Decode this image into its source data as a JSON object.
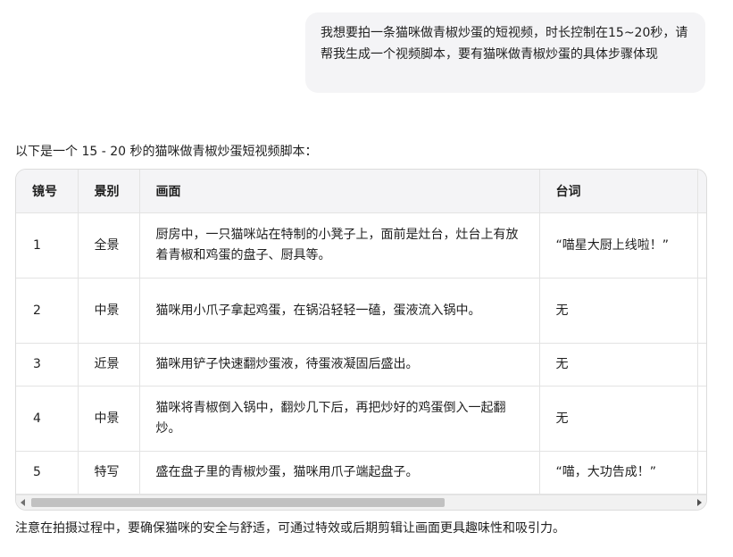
{
  "user_message": "我想要拍一条猫咪做青椒炒蛋的短视频，时长控制在15~20秒，请帮我生成一个视频脚本，要有猫咪做青椒炒蛋的具体步骤体现",
  "intro": "以下是一个 15 - 20 秒的猫咪做青椒炒蛋短视频脚本：",
  "table": {
    "headers": [
      "镜号",
      "景别",
      "画面",
      "台词"
    ],
    "rows": [
      {
        "num": "1",
        "shot": "全景",
        "scene": "厨房中，一只猫咪站在特制的小凳子上，面前是灶台，灶台上有放着青椒和鸡蛋的盘子、厨具等。",
        "line": "“喵星大厨上线啦！”"
      },
      {
        "num": "2",
        "shot": "中景",
        "scene": "猫咪用小爪子拿起鸡蛋，在锅沿轻轻一磕，蛋液流入锅中。",
        "line": "无"
      },
      {
        "num": "3",
        "shot": "近景",
        "scene": "猫咪用铲子快速翻炒蛋液，待蛋液凝固后盛出。",
        "line": "无"
      },
      {
        "num": "4",
        "shot": "中景",
        "scene": "猫咪将青椒倒入锅中，翻炒几下后，再把炒好的鸡蛋倒入一起翻炒。",
        "line": "无"
      },
      {
        "num": "5",
        "shot": "特写",
        "scene": "盛在盘子里的青椒炒蛋，猫咪用爪子端起盘子。",
        "line": "“喵，大功告成！”"
      }
    ]
  },
  "note": "注意在拍摄过程中，要确保猫咪的安全与舒适，可通过特效或后期剪辑让画面更具趣味性和吸引力。"
}
